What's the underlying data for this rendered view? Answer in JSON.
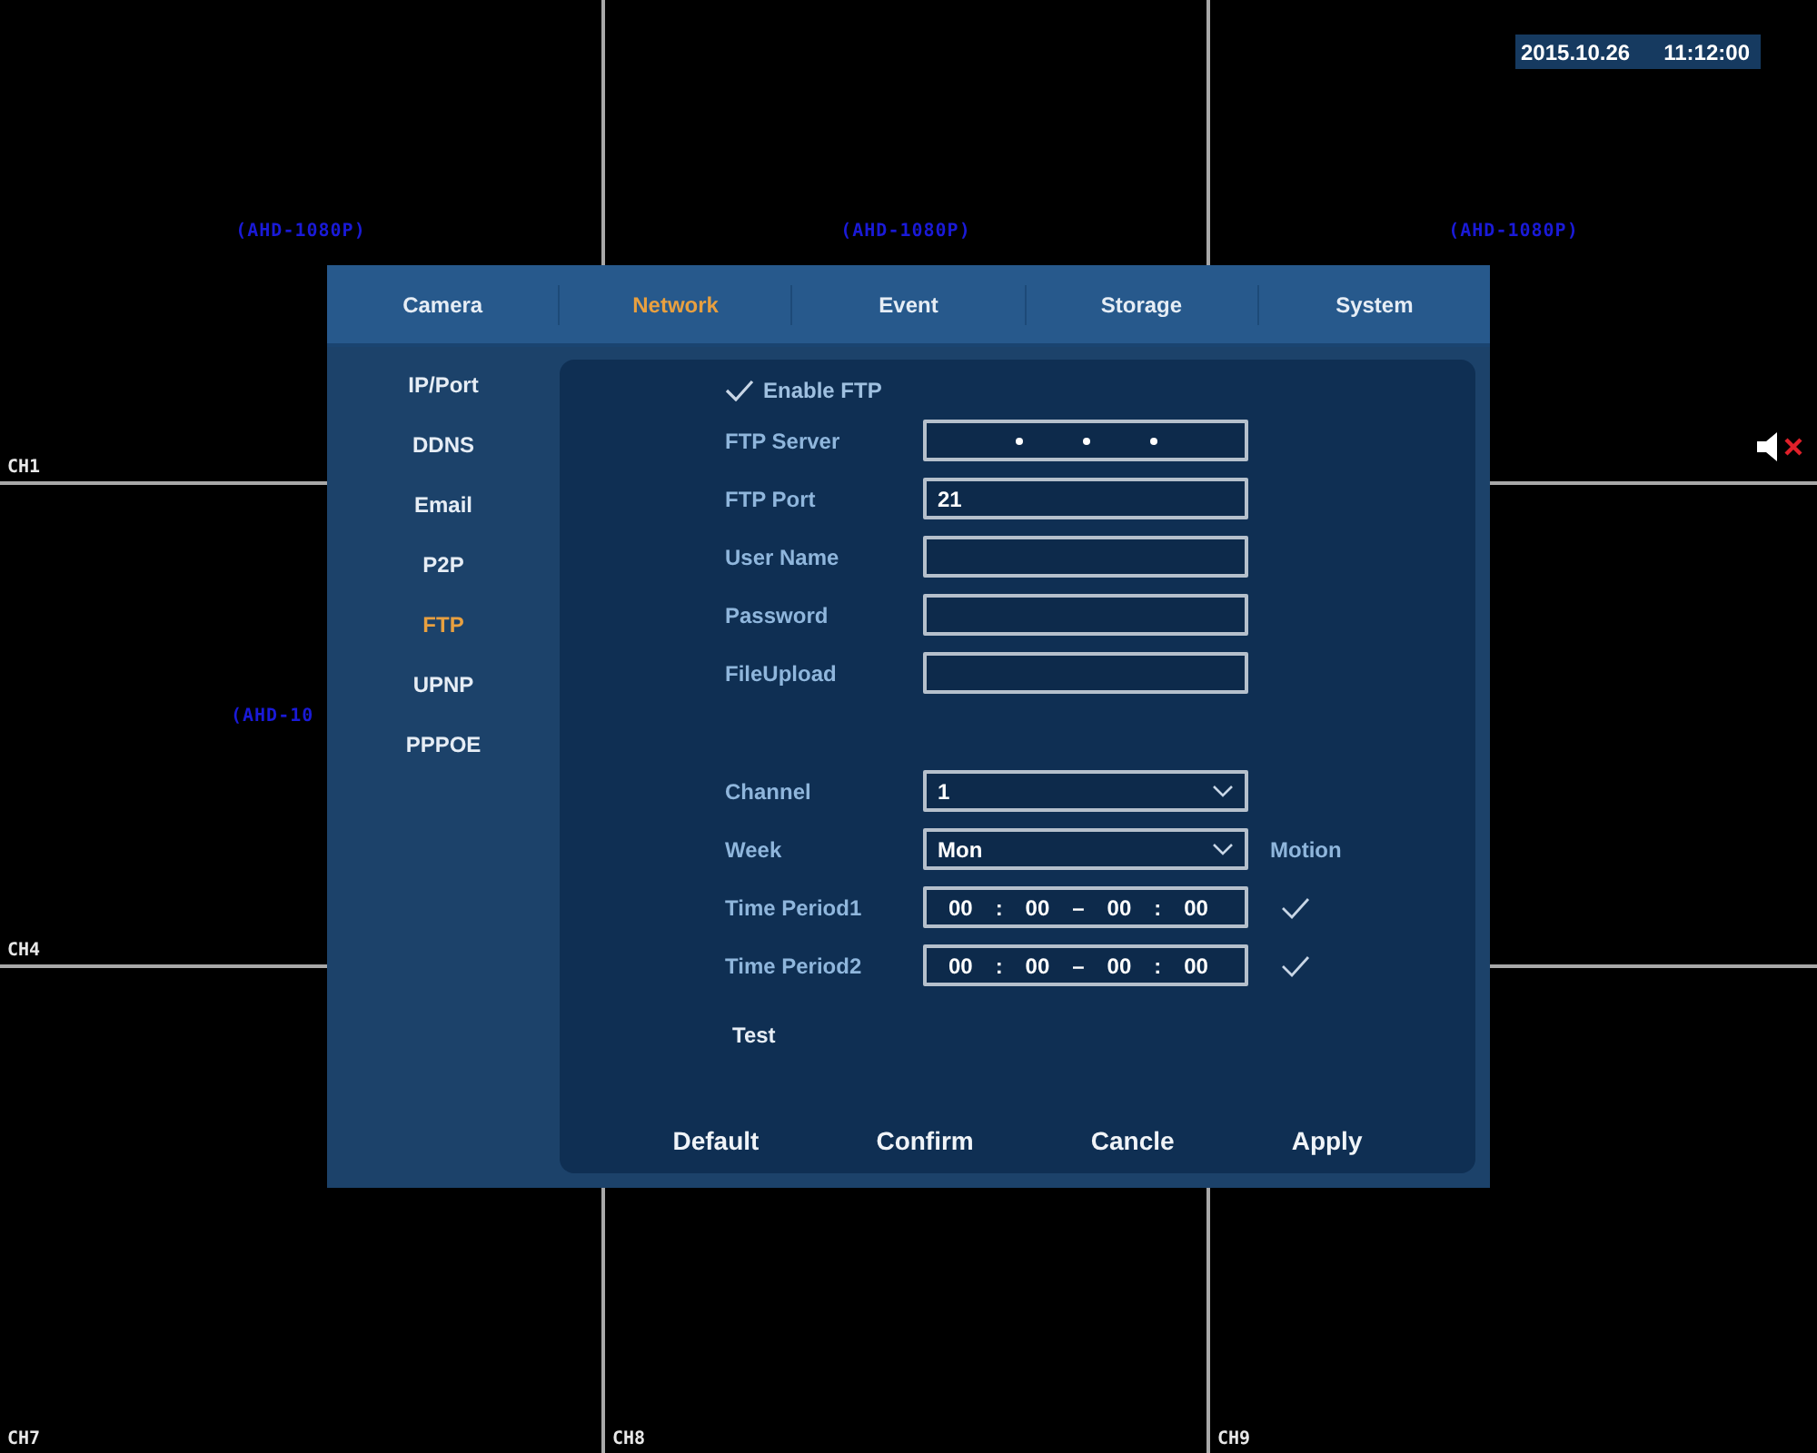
{
  "datetime": {
    "date": "2015.10.26",
    "time": "11:12:00"
  },
  "cells": [
    {
      "resolution": "(AHD-1080P)",
      "channel": "CH1"
    },
    {
      "resolution": "(AHD-1080P)"
    },
    {
      "resolution": "(AHD-1080P)",
      "muted": true
    },
    {
      "resolution": "(AHD-10",
      "channel": "CH4"
    },
    {},
    {},
    {
      "channel": "CH7"
    },
    {
      "channel": "CH8"
    },
    {
      "channel": "CH9"
    }
  ],
  "tabs": [
    {
      "label": "Camera",
      "selected": false
    },
    {
      "label": "Network",
      "selected": true
    },
    {
      "label": "Event",
      "selected": false
    },
    {
      "label": "Storage",
      "selected": false
    },
    {
      "label": "System",
      "selected": false
    }
  ],
  "sidebar": {
    "items": [
      {
        "label": "IP/Port",
        "selected": false
      },
      {
        "label": "DDNS",
        "selected": false
      },
      {
        "label": "Email",
        "selected": false
      },
      {
        "label": "P2P",
        "selected": false
      },
      {
        "label": "FTP",
        "selected": true
      },
      {
        "label": "UPNP",
        "selected": false
      },
      {
        "label": "PPPOE",
        "selected": false
      }
    ]
  },
  "enable": {
    "label": "Enable FTP",
    "checked": true
  },
  "fields": [
    {
      "kind": "ip",
      "label": "FTP Server"
    },
    {
      "kind": "text",
      "label": "FTP Port",
      "value": "21"
    },
    {
      "kind": "text",
      "label": "User Name"
    },
    {
      "kind": "text",
      "label": "Password"
    },
    {
      "kind": "text",
      "label": "FileUpload"
    }
  ],
  "schedule": {
    "motion_header": "Motion",
    "rows": [
      {
        "kind": "select",
        "label": "Channel",
        "value": "1"
      },
      {
        "kind": "select",
        "label": "Week",
        "value": "Mon"
      },
      {
        "kind": "time",
        "label": "Time Period1",
        "parts": [
          "00",
          ":",
          "00",
          "–",
          "00",
          ":",
          "00"
        ],
        "motion": true
      },
      {
        "kind": "time",
        "label": "Time Period2",
        "parts": [
          "00",
          ":",
          "00",
          "–",
          "00",
          ":",
          "00"
        ],
        "motion": true
      }
    ]
  },
  "test_button": "Test",
  "buttons": [
    "Default",
    "Confirm",
    "Cancle",
    "Apply"
  ]
}
